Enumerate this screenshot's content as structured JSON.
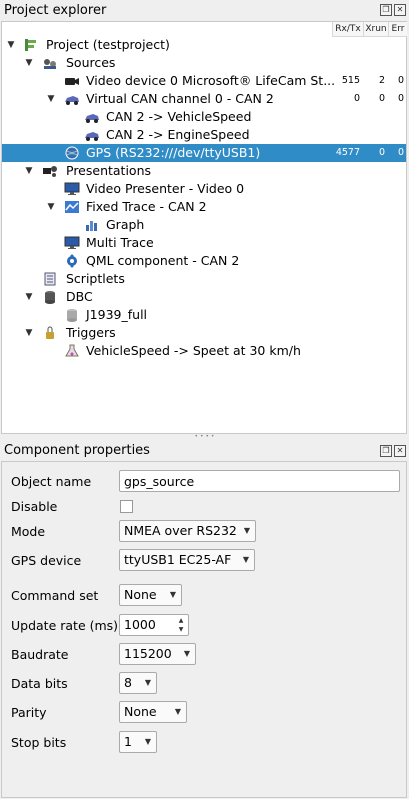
{
  "explorer": {
    "title": "Project explorer",
    "columns": {
      "rxtx": "Rx/Tx",
      "xrun": "Xrun",
      "err": "Err"
    },
    "project": "Project (testproject)",
    "sources": "Sources",
    "video_device": {
      "label": "Video device 0 Microsoft® LifeCam St...",
      "rxtx": "515",
      "xrun": "2",
      "err": "0"
    },
    "vcan": {
      "label": "Virtual CAN channel 0 - CAN 2",
      "rxtx": "0",
      "xrun": "0",
      "err": "0"
    },
    "vehicle_speed": "CAN 2 -> VehicleSpeed",
    "engine_speed": "CAN 2 -> EngineSpeed",
    "gps": {
      "label": "GPS (RS232:///dev/ttyUSB1)",
      "rxtx": "4577",
      "xrun": "0",
      "err": "0"
    },
    "presentations": "Presentations",
    "video_presenter": "Video Presenter - Video 0",
    "fixed_trace": "Fixed Trace - CAN 2",
    "graph": "Graph",
    "multi_trace": "Multi Trace",
    "qml": "QML component - CAN 2",
    "scriptlets": "Scriptlets",
    "dbc": "DBC",
    "j1939": "J1939_full",
    "triggers": "Triggers",
    "trigger1": "VehicleSpeed -> Speet at 30 km/h"
  },
  "props": {
    "title": "Component properties",
    "object_name": {
      "label": "Object name",
      "value": "gps_source"
    },
    "disable": {
      "label": "Disable"
    },
    "mode": {
      "label": "Mode",
      "value": "NMEA over RS232"
    },
    "gps_device": {
      "label": "GPS device",
      "value": "ttyUSB1 EC25-AF"
    },
    "command_set": {
      "label": "Command set",
      "value": "None"
    },
    "update_rate": {
      "label": "Update rate (ms)",
      "value": "1000"
    },
    "baudrate": {
      "label": "Baudrate",
      "value": "115200"
    },
    "data_bits": {
      "label": "Data bits",
      "value": "8"
    },
    "parity": {
      "label": "Parity",
      "value": "None"
    },
    "stop_bits": {
      "label": "Stop bits",
      "value": "1"
    }
  },
  "colors": {
    "selection": "#308cc6"
  }
}
